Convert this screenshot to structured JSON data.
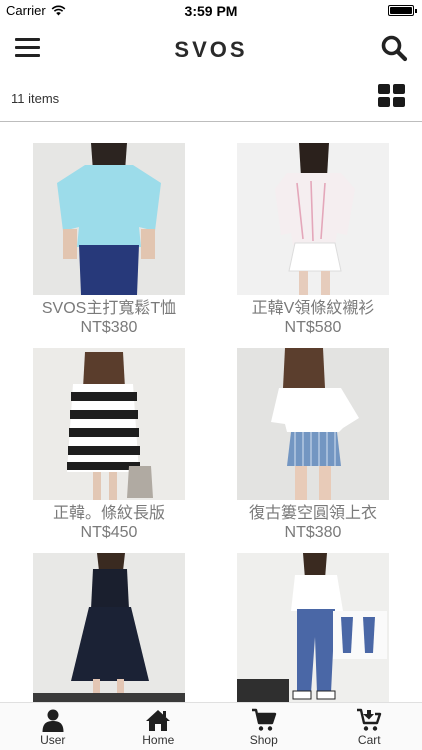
{
  "status_bar": {
    "carrier": "Carrier",
    "time": "3:59 PM",
    "battery_level": 1.0
  },
  "nav": {
    "title": "SVOS",
    "menu_icon": "hamburger-menu-icon",
    "search_icon": "search-icon"
  },
  "toolbar": {
    "item_count": "11 items",
    "view_icon": "grid-view-icon"
  },
  "products": [
    {
      "name": "SVOS主打寬鬆T恤",
      "price": "NT$380"
    },
    {
      "name": "正韓V領條紋襯衫",
      "price": "NT$580"
    },
    {
      "name": "正韓。條紋長版",
      "price": "NT$450"
    },
    {
      "name": "復古簍空圓領上衣",
      "price": "NT$380"
    },
    {
      "name": "",
      "price": ""
    },
    {
      "name": "",
      "price": ""
    }
  ],
  "tabs": [
    {
      "label": "User",
      "icon": "user-icon"
    },
    {
      "label": "Home",
      "icon": "home-icon"
    },
    {
      "label": "Shop",
      "icon": "shopping-cart-icon"
    },
    {
      "label": "Cart",
      "icon": "cart-download-icon"
    }
  ]
}
